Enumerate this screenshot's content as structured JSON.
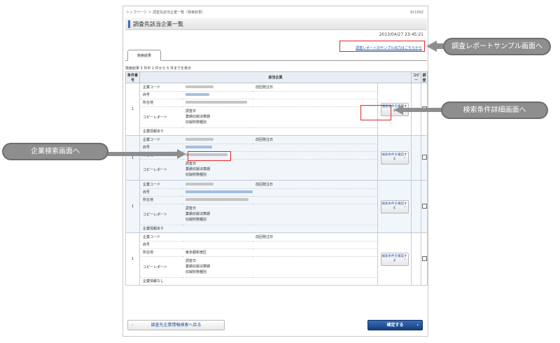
{
  "breadcrumb": "トップページ ＞ 調査先該当企業一覧（検索結果）",
  "screen_id": "911002",
  "page_title": "調査先該当企業一覧",
  "timestamp": "2013/04/27 23:45:21",
  "sample_link": "調査レポートのサンプル出力はこちらから",
  "tab_label": "検索結果",
  "result_count": "検索結果 5 件中 1 件から 5 件までを表示",
  "table": {
    "headers": {
      "no": "条件番号",
      "company": "該当企業",
      "copy": "コピー",
      "survey": "調査"
    },
    "labels": {
      "code": "企業コード",
      "name": "商号",
      "address": "所在地",
      "copy_report": "コピーレポート",
      "last_order": "前回発注日",
      "survey_date": "調査日",
      "settlement": "業績収録決算期",
      "financial_type": "収録財務種別"
    },
    "detail_button": "検索条件を確認する",
    "rows": [
      {
        "no": "1",
        "footer": "企業情報あり",
        "address": ""
      },
      {
        "no": "1",
        "footer": "",
        "address": ""
      },
      {
        "no": "1",
        "footer": "企業情報あり",
        "address": ""
      },
      {
        "no": "1",
        "footer": "企業情報なし",
        "address": "東京都新宿区"
      }
    ]
  },
  "back_button": "調査先企業情報検索へ戻る",
  "confirm_button": "確定する",
  "callouts": {
    "report_sample": "調査レポートサンプル画面へ",
    "search_detail": "検索条件詳細画面へ",
    "company_search": "企業検索画面へ"
  }
}
